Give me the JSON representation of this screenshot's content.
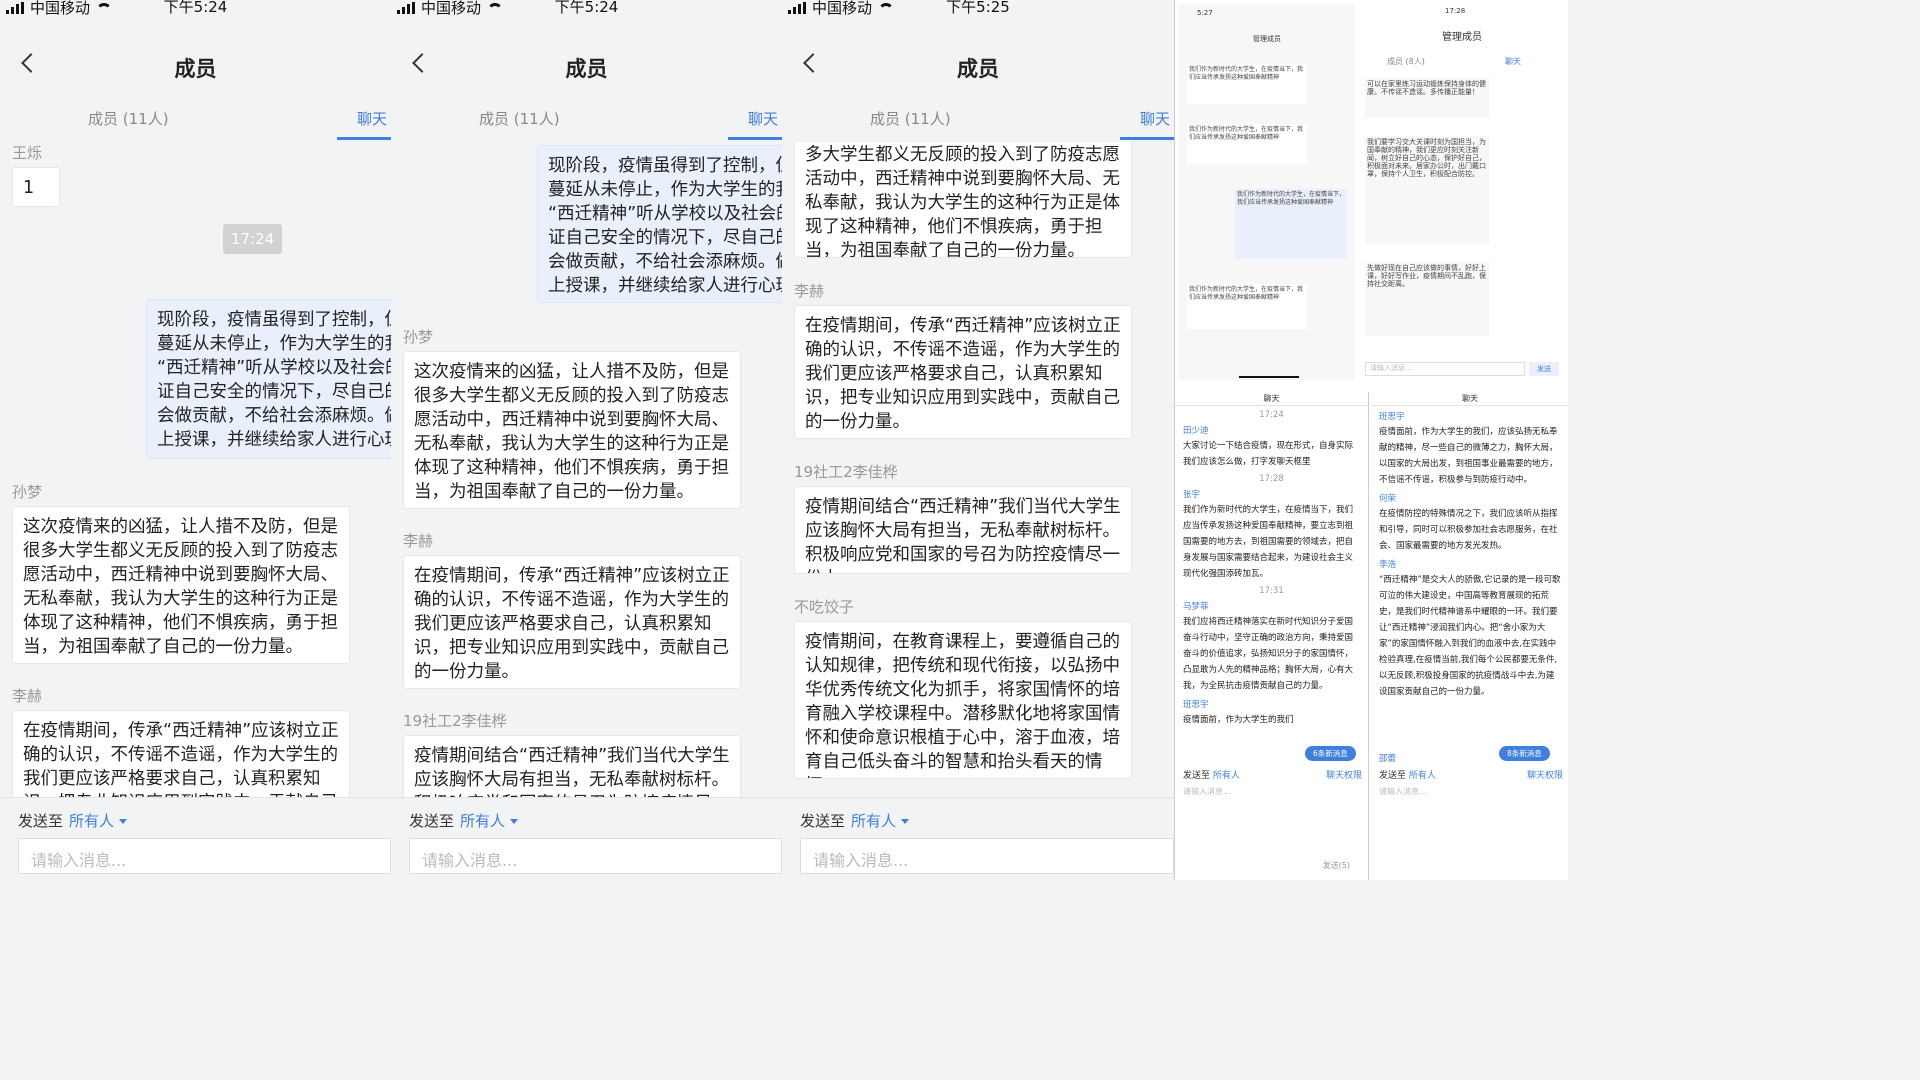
{
  "status": {
    "carrier": "中国移动",
    "times": [
      "下午5:24",
      "下午5:24",
      "下午5:25"
    ]
  },
  "header": {
    "title": "成员",
    "tab_members": "成员 (11人)",
    "tab_chat": "聊天"
  },
  "footer": {
    "send_to": "发送至",
    "recipient": "所有人",
    "input_placeholder": "请输入消息..."
  },
  "messages": {
    "wangshuo_name": "王烁",
    "wangshuo_text": "1",
    "time_1724": "17:24",
    "me_text": [
      "现阶段，疫情虽得到了控制，但",
      "蔓延从未停止，作为大学生的我",
      "“西迁精神”听从学校以及社会的",
      "证自己安全的情况下，尽自己的",
      "会做贡献，不给社会添麻烦。做",
      "上授课，并继续给家人进行心理"
    ],
    "sunmeng_name": "孙梦",
    "sunmeng_text": "这次疫情来的凶猛，让人措不及防，但是很多大学生都义无反顾的投入到了防疫志愿活动中，西迁精神中说到要胸怀大局、无私奉献，我认为大学生的这种行为正是体现了这种精神，他们不惧疾病，勇于担当，为祖国奉献了自己的一份力量。",
    "sunmeng_tail": "多大学生都义无反顾的投入到了防疫志愿活动中，西迁精神中说到要胸怀大局、无私奉献，我认为大学生的这种行为正是体现了这种精神，他们不惧疾病，勇于担当，为祖国奉献了自己的一份力量。",
    "lihe_name": "李赫",
    "lihe_text": "在疫情期间，传承“西迁精神”应该树立正确的认识，不传谣不造谣，作为大学生的我们更应该严格要求自己，认真积累知识，把专业知识应用到实践中，贡献自己的一份力量。",
    "lijiahua_name": "19社工2李佳桦",
    "lijiahua_text": "疫情期间结合“西迁精神”我们当代大学生应该胸怀大局有担当，无私奉献树标杆。积极响应党和国家的号召为防控疫情尽一份力。",
    "buchi_name": "不吃饺子",
    "buchi_text": "疫情期间，在教育课程上，要遵循自己的认知规律，把传统和现代衔接，以弘扬中华优秀传统文化为抓手，将家国情怀的培育融入学校课程中。潜移默化地将家国情怀和使命意识根植于心中，溶于血液，培育自己低头奋斗的智慧和抬头看天的情怀。"
  },
  "thumbs": {
    "a_time": "5:27",
    "a_title": "管理成员",
    "b_time": "17:28",
    "b_title": "管理成员",
    "b_tab_members": "成员 (8人)",
    "b_tab_chat": "聊天",
    "b_send": "发送",
    "a_text": "我们作为新时代的大学生，在疫情当下，我们应当传承发扬这种爱国奉献精神",
    "b_text": "可以在家里练习运动锻炼保持身体的健康。不传谣不造谣。多传播正能量！",
    "b_text2": "我们要学习交大关课时刻为国担当，为国奉献的精神，我们更应时刻关注新闻，树立好自己的心态，保护好自己，积极面对未来。居家办公时，出门戴口罩，保持个人卫生，积极配合防控。",
    "b_text3": "先做好现在自己应该做的事情，好好上课，好好写作业，疫情期间不乱跑，保持社交距离。"
  },
  "chat_left": {
    "title": "聊天",
    "time1": "17:24",
    "n1": "田少迪",
    "m1": "大家讨论一下结合疫情，现在形式，自身实际我们应该怎么做，打字发聊天框里",
    "time2": "17:28",
    "n2": "张宇",
    "m2": "我们作为新时代的大学生，在疫情当下，我们应当传承发扬这种爱国奉献精神，要立志到祖国需要的地方去，到祖国需要的领域去，把自身发展与国家需要结合起来，为建设社会主义现代化强国添砖加瓦。",
    "time3": "17:31",
    "n3": "马梦菲",
    "m3": "我们应将西迁精神落实在新时代知识分子爱国奋斗行动中，坚守正确的政治方向，秉持爱国奋斗的价值追求，弘扬知识分子的家国情怀，凸显敢为人先的精神品格；胸怀大局，心有大我，为全民抗击疫情贡献自己的力量。",
    "n4": "班思宇",
    "m4": "疫情面前，作为大学生的我们",
    "new": "6条新消息",
    "send_to": "发送至",
    "recipient": "所有人",
    "perm": "聊天权限",
    "placeholder": "请输入消息...",
    "send": "发送(5)"
  },
  "chat_right": {
    "title": "聊天",
    "n1": "班思宇",
    "m1": "疫情面前，作为大学生的我们，应该弘扬无私奉献的精神，尽一些自己的微薄之力，胸怀大局，以国家的大局出发，到祖国事业最需要的地方，不信谣不传谣，积极参与到防疫行动中。",
    "n2": "何荣",
    "m2": "在疫情防控的特殊情况之下，我们应该听从指挥和引导，同时可以积极参加社会志愿服务，在社会、国家最需要的地方发光发热。",
    "n3": "李浩",
    "m3": "“西迁精神”是交大人的骄傲,它记录的是一段可歌可泣的伟大建设史，中国高等教育展现的拓荒史，是我们时代精神谱系中耀眼的一环。我们要让“西迁精神”浸润我们内心。把“舍小家为大家”的家国情怀融入到我们的血液中去,在实践中检验真理,在疫情当前,我们每个公民都要无条件,以无反顾,积极投身国家的抗疫情战斗中去,为建设国家贡献自己的一份力量。",
    "n4": "邵蕾",
    "new": "8条新消息",
    "send_to": "发送至",
    "recipient": "所有人",
    "perm": "聊天权限",
    "placeholder": "请输入消息..."
  },
  "colors": {
    "accent": "#3f7fe0",
    "bg": "#f2f3f5",
    "self_bubble": "#e9effb"
  }
}
